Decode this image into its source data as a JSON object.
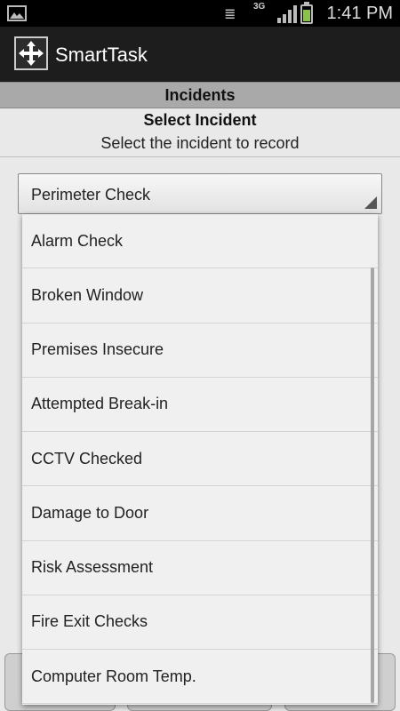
{
  "status_bar": {
    "network": "3G",
    "time": "1:41 PM",
    "icons": [
      "gallery-icon",
      "mute-icon",
      "signal-icon",
      "battery-icon"
    ],
    "battery_color": "#8bc34a"
  },
  "action_bar": {
    "app_title": "SmartTask",
    "logo_icon": "smarttask-logo-icon"
  },
  "section": {
    "title": "Incidents"
  },
  "prompt": {
    "heading": "Select Incident",
    "description": "Select the incident to record"
  },
  "select": {
    "value": "Perimeter Check",
    "options": [
      "Alarm Check",
      "Broken Window",
      "Premises Insecure",
      "Attempted Break-in",
      "CCTV Checked",
      "Damage to Door",
      "Risk Assessment",
      "Fire Exit Checks",
      "Computer Room Temp."
    ]
  },
  "colors": {
    "header_bar": "#a9a9a9",
    "action_bar": "#1d1d1d",
    "background": "#e9e9e9"
  }
}
